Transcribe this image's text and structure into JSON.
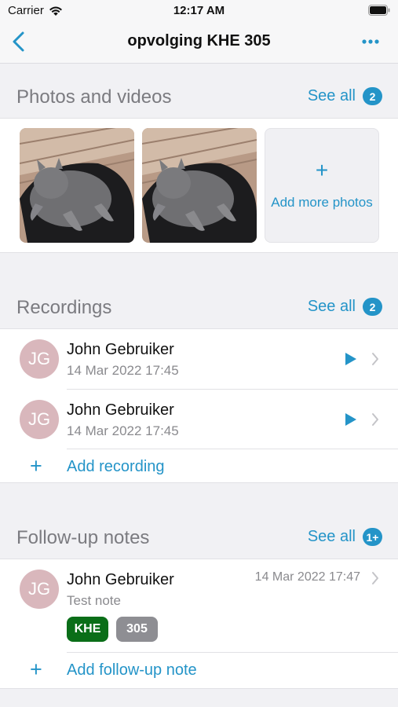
{
  "status_bar": {
    "carrier": "Carrier",
    "time": "12:17 AM"
  },
  "nav": {
    "title": "opvolging KHE 305"
  },
  "photos": {
    "title": "Photos and videos",
    "see_all": "See all",
    "count": "2",
    "add_label": "Add more photos",
    "add_symbol": "+"
  },
  "recordings": {
    "title": "Recordings",
    "see_all": "See all",
    "count": "2",
    "items": [
      {
        "initials": "JG",
        "name": "John Gebruiker",
        "date": "14 Mar 2022 17:45"
      },
      {
        "initials": "JG",
        "name": "John Gebruiker",
        "date": "14 Mar 2022 17:45"
      }
    ],
    "add_label": "Add recording",
    "add_symbol": "+"
  },
  "notes": {
    "title": "Follow-up notes",
    "see_all": "See all",
    "count": "1+",
    "items": [
      {
        "initials": "JG",
        "name": "John Gebruiker",
        "text": "Test note",
        "date": "14 Mar 2022 17:47",
        "tags": [
          {
            "label": "KHE",
            "color": "#0a6e18"
          },
          {
            "label": "305",
            "color": "#8e8e93"
          }
        ]
      }
    ],
    "add_label": "Add follow-up note",
    "add_symbol": "+"
  },
  "colors": {
    "accent": "#2494c8",
    "avatar": "#d9b7bc",
    "background": "#f1f1f4"
  },
  "icons": [
    "wifi-icon",
    "battery-icon",
    "back-chevron-icon",
    "more-icon",
    "play-icon",
    "chevron-right-icon",
    "plus-icon"
  ]
}
